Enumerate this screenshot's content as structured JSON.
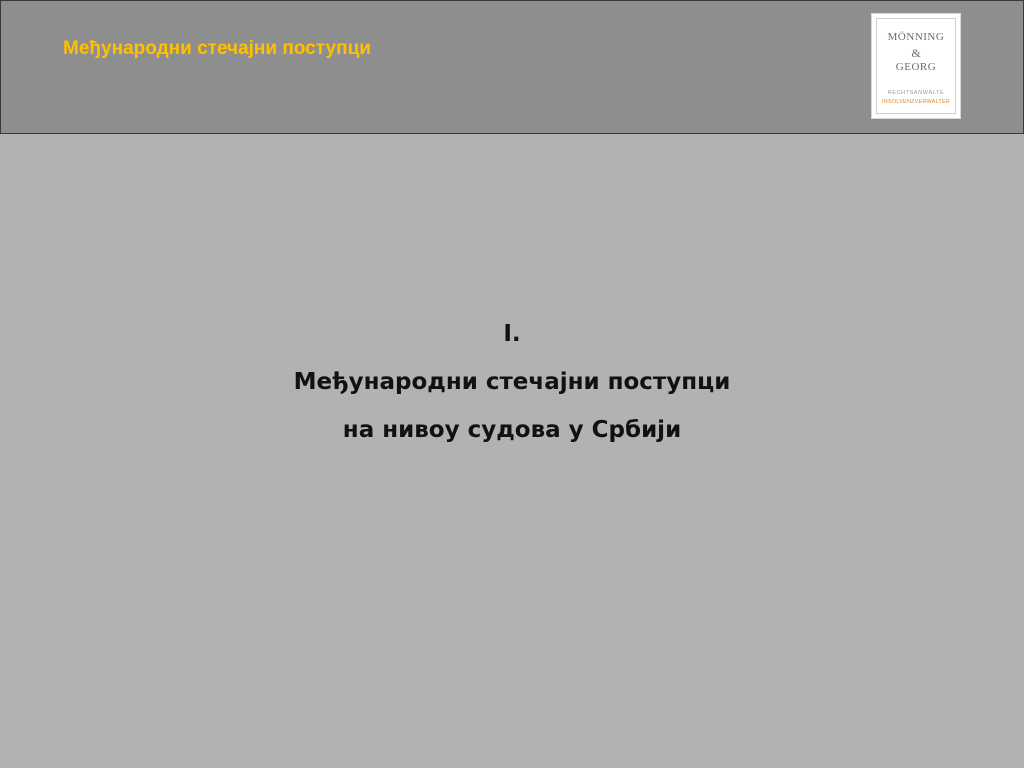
{
  "header": {
    "title": "Међународни стечајни поступци",
    "title_color": "#ffc000",
    "background": "#8e8e8e"
  },
  "logo": {
    "line1": "MÖNNING",
    "line2": "&",
    "line3": "GEORG",
    "line4": "RECHTSANWÄLTE",
    "line5": "INSOLVENZVERWALTER"
  },
  "content": {
    "section_number": "I.",
    "line1": "Међународни стечајни поступци",
    "line2": "на нивоу судова у Србији"
  },
  "colors": {
    "slide_background": "#b2b2b2",
    "accent": "#ffc000"
  }
}
